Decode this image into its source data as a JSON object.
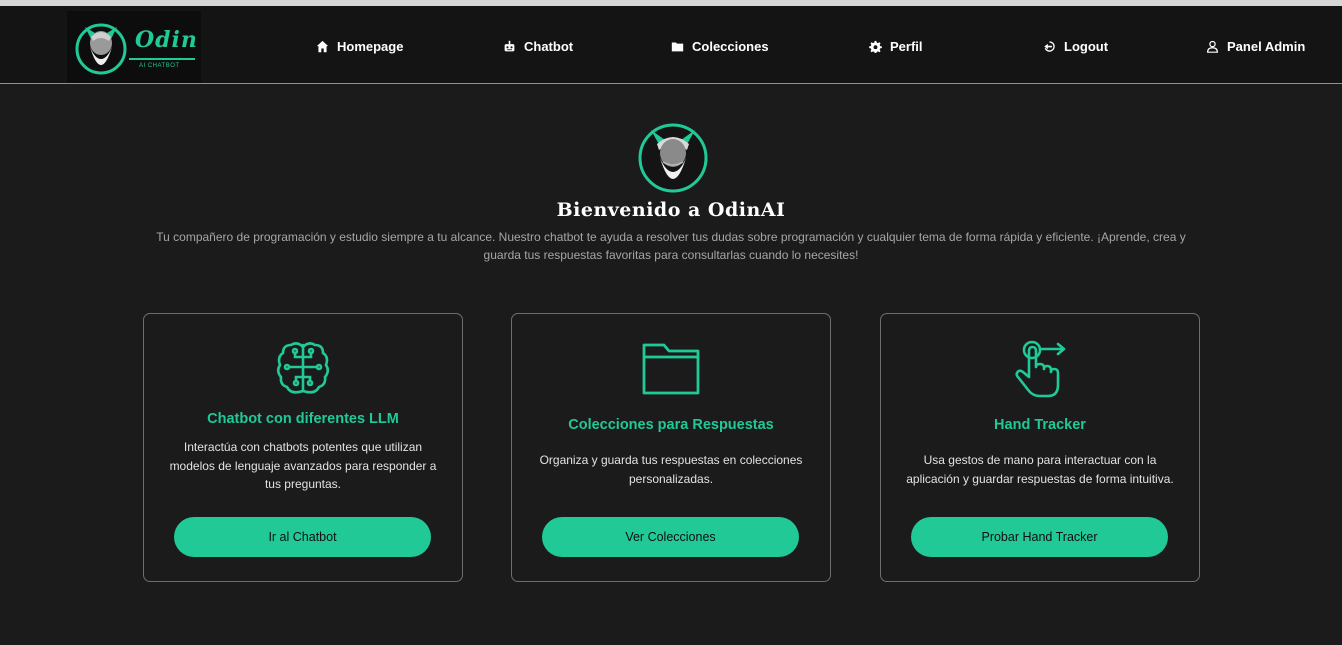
{
  "colors": {
    "accent": "#21c997",
    "background": "#1b1b1c",
    "navbar": "#141414",
    "card_border": "#6e6e6e"
  },
  "brand": {
    "name": "Odin",
    "subtitle": "AI CHATBOT",
    "icon": "viking-logo-icon"
  },
  "nav": [
    {
      "label": "Homepage",
      "icon": "home-icon"
    },
    {
      "label": "Chatbot",
      "icon": "robot-icon"
    },
    {
      "label": "Colecciones",
      "icon": "folder-icon"
    },
    {
      "label": "Perfil",
      "icon": "gear-icon"
    },
    {
      "label": "Logout",
      "icon": "logout-icon"
    },
    {
      "label": "Panel Admin",
      "icon": "user-icon"
    }
  ],
  "hero": {
    "title": "Bienvenido a OdinAI",
    "description": "Tu compañero de programación y estudio siempre a tu alcance. Nuestro chatbot te ayuda a resolver tus dudas sobre programación y cualquier tema de forma rápida y eficiente. ¡Aprende, crea y guarda tus respuestas favoritas para consultarlas cuando lo necesites!"
  },
  "cards": [
    {
      "icon": "brain-circuit-icon",
      "title": "Chatbot con diferentes LLM",
      "description": "Interactúa con chatbots potentes que utilizan modelos de lenguaje avanzados para responder a tus preguntas.",
      "button": "Ir al Chatbot"
    },
    {
      "icon": "folder-outline-icon",
      "title": "Colecciones para Respuestas",
      "description": "Organiza y guarda tus respuestas en colecciones personalizadas.",
      "button": "Ver Colecciones"
    },
    {
      "icon": "hand-gesture-icon",
      "title": "Hand Tracker",
      "description": "Usa gestos de mano para interactuar con la aplicación y guardar respuestas de forma intuitiva.",
      "button": "Probar Hand Tracker"
    }
  ]
}
